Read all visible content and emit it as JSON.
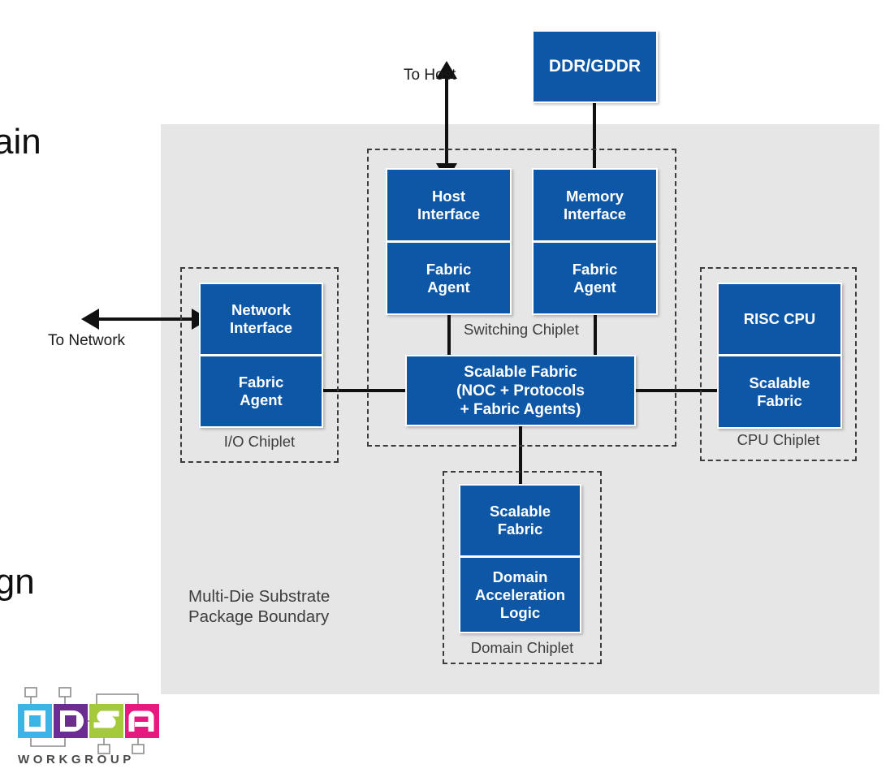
{
  "slide": {
    "text_fragment_top": "ain",
    "text_fragment_bottom": "ign"
  },
  "package": {
    "label": "Multi-Die Substrate\nPackage Boundary",
    "background_color": "#e6e6e6"
  },
  "theme": {
    "block_color": "#0d57a6",
    "line_color": "#111111",
    "dash_color": "#3c3c3c",
    "text_color": "#3d3d3d"
  },
  "external_blocks": [
    {
      "name": "ddr",
      "label": "DDR/GDDR"
    }
  ],
  "connectors": [
    {
      "name": "to-host",
      "label": "To Host"
    },
    {
      "name": "to-network",
      "label": "To Network"
    }
  ],
  "chiplets": [
    {
      "id": "io",
      "label": "I/O Chiplet",
      "blocks": [
        {
          "name": "network-interface",
          "label": "Network\nInterface"
        },
        {
          "name": "fabric-agent",
          "label": "Fabric\nAgent"
        }
      ]
    },
    {
      "id": "switching",
      "label": "Switching Chiplet",
      "blocks": [
        {
          "name": "host-interface",
          "label": "Host\nInterface"
        },
        {
          "name": "host-fabric-agent",
          "label": "Fabric\nAgent"
        },
        {
          "name": "memory-interface",
          "label": "Memory\nInterface"
        },
        {
          "name": "memory-fabric-agent",
          "label": "Fabric\nAgent"
        },
        {
          "name": "scalable-fabric-main",
          "label": "Scalable Fabric\n(NOC + Protocols\n+ Fabric Agents)"
        }
      ]
    },
    {
      "id": "cpu",
      "label": "CPU Chiplet",
      "blocks": [
        {
          "name": "risc-cpu",
          "label": "RISC CPU"
        },
        {
          "name": "cpu-scalable-fabric",
          "label": "Scalable\nFabric"
        }
      ]
    },
    {
      "id": "domain",
      "label": "Domain Chiplet",
      "blocks": [
        {
          "name": "domain-scalable-fabric",
          "label": "Scalable\nFabric"
        },
        {
          "name": "domain-acceleration-logic",
          "label": "Domain\nAcceleration\nLogic"
        }
      ]
    }
  ],
  "logo": {
    "name": "odsa-workgroup-logo",
    "wordmark": "WORKGROUP",
    "letters": [
      "O",
      "D",
      "S",
      "A"
    ],
    "colors": [
      "#3cb4e5",
      "#6b2d90",
      "#a4c93a",
      "#e5197f"
    ]
  }
}
